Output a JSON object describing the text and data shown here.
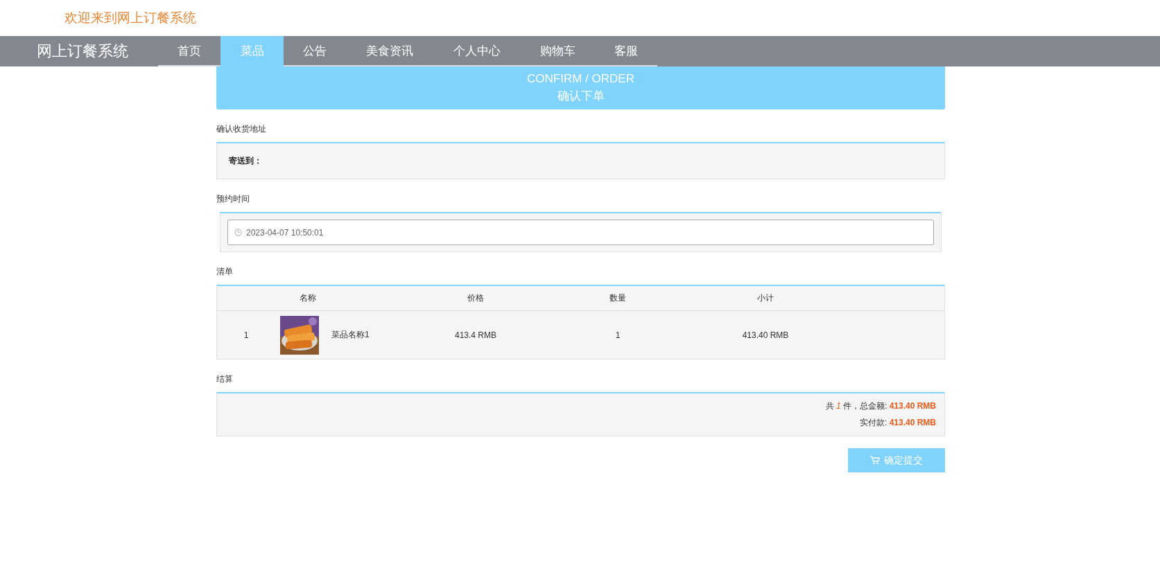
{
  "header": {
    "welcome": "欢迎来到网上订餐系统"
  },
  "nav": {
    "brand": "网上订餐系统",
    "items": [
      {
        "label": "首页",
        "selected": false
      },
      {
        "label": "菜品",
        "selected": true
      },
      {
        "label": "公告",
        "selected": false
      },
      {
        "label": "美食资讯",
        "selected": false
      },
      {
        "label": "个人中心",
        "selected": false
      },
      {
        "label": "购物车",
        "selected": false
      },
      {
        "label": "客服",
        "selected": false
      }
    ]
  },
  "banner": {
    "title_en": "CONFIRM / ORDER",
    "title_zh": "确认下单"
  },
  "address": {
    "heading": "确认收货地址",
    "label": "寄送到："
  },
  "time": {
    "heading": "预约时间",
    "value": "2023-04-07 10:50:01"
  },
  "items": {
    "heading": "清单",
    "columns": [
      "名称",
      "价格",
      "数量",
      "小计"
    ],
    "rows": [
      {
        "index": "1",
        "name": "菜品名称1",
        "price": "413.4 RMB",
        "quantity": "1",
        "subtotal": "413.40 RMB"
      }
    ]
  },
  "settlement": {
    "heading": "结算",
    "count_prefix": "共",
    "count": "1",
    "count_suffix": "件，总金额:",
    "total": "413.40 RMB",
    "paid_label": "实付款:",
    "paid": "413.40 RMB"
  },
  "submit": {
    "label": "确定提交"
  }
}
